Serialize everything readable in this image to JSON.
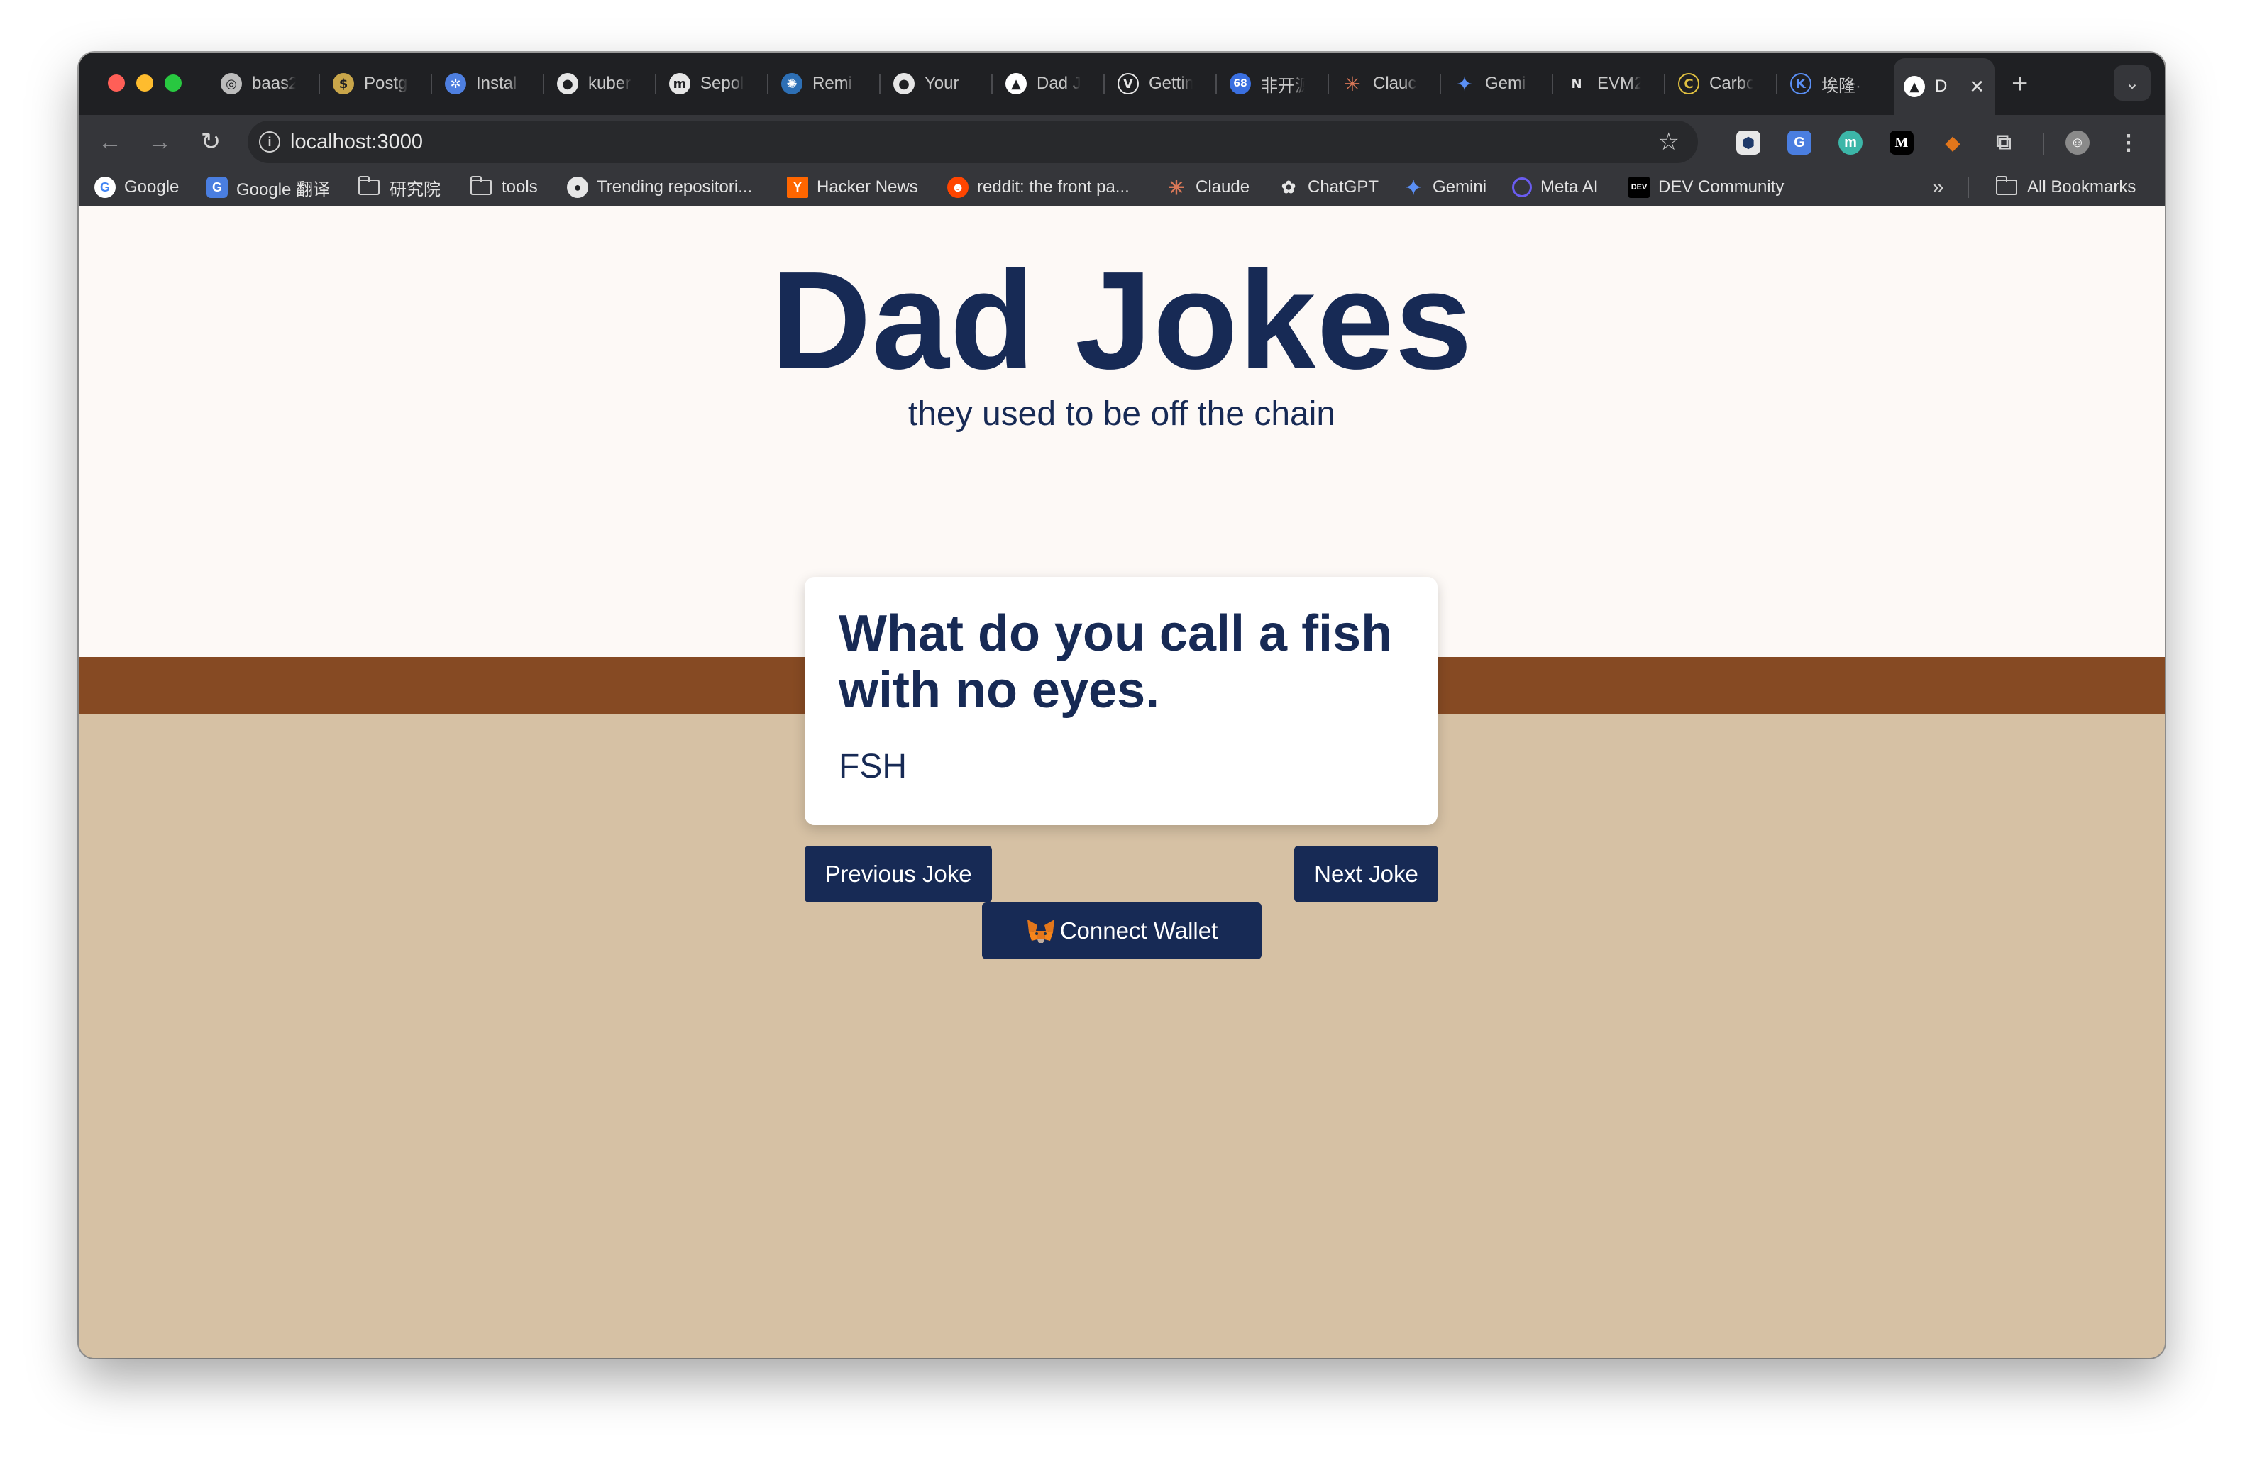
{
  "browser": {
    "tabs": [
      {
        "title": "baas2",
        "icon": "openai-icon"
      },
      {
        "title": "Postg",
        "icon": "coin-icon"
      },
      {
        "title": "Instal",
        "icon": "kubernetes-icon"
      },
      {
        "title": "kuber",
        "icon": "github-icon"
      },
      {
        "title": "Sepol",
        "icon": "explorer-icon"
      },
      {
        "title": "Remi",
        "icon": "remix-icon"
      },
      {
        "title": "Your",
        "icon": "github-icon"
      },
      {
        "title": "Dad J",
        "icon": "triangle-icon"
      },
      {
        "title": "Gettin",
        "icon": "vue-icon"
      },
      {
        "title": "非开源",
        "icon": "badge-icon"
      },
      {
        "title": "Clauc",
        "icon": "claude-icon"
      },
      {
        "title": "Gemi",
        "icon": "gemini-icon"
      },
      {
        "title": "EVM2",
        "icon": "notion-icon"
      },
      {
        "title": "Carbo",
        "icon": "carbon-icon"
      },
      {
        "title": "埃隆·",
        "icon": "kimi-icon"
      }
    ],
    "active_tab": {
      "title": "D",
      "icon": "triangle-icon",
      "close": "✕"
    },
    "new_tab": "+",
    "tab_search": "⌄",
    "address": "localhost:3000",
    "bookmarks": [
      {
        "label": "Google",
        "icon": "google-icon"
      },
      {
        "label": "Google 翻译",
        "icon": "google-translate-icon"
      },
      {
        "label": "研究院",
        "icon": "folder-icon"
      },
      {
        "label": "tools",
        "icon": "folder-icon"
      },
      {
        "label": "Trending repositori...",
        "icon": "github-icon"
      },
      {
        "label": "Hacker News",
        "icon": "hacker-news-icon"
      },
      {
        "label": "reddit: the front pa...",
        "icon": "reddit-icon"
      },
      {
        "label": "Claude",
        "icon": "claude-icon"
      },
      {
        "label": "ChatGPT",
        "icon": "chatgpt-icon"
      },
      {
        "label": "Gemini",
        "icon": "gemini-icon"
      },
      {
        "label": "Meta AI",
        "icon": "meta-ai-icon"
      },
      {
        "label": "DEV Community",
        "icon": "dev-icon"
      }
    ],
    "bookmarks_overflow": "»",
    "all_bookmarks": "All Bookmarks"
  },
  "page": {
    "title": "Dad Jokes",
    "subtitle": "they used to be off the chain",
    "joke": {
      "question": "What do you call a fish with no eyes.",
      "answer": "FSH"
    },
    "buttons": {
      "previous": "Previous Joke",
      "next": "Next Joke",
      "wallet": "Connect Wallet"
    }
  },
  "colors": {
    "navy": "#172a55",
    "hero_bg": "#fdf9f6",
    "stripe": "#864a23",
    "tan": "#d6c1a4"
  }
}
